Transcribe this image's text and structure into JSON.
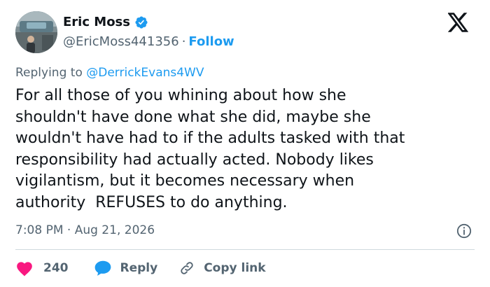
{
  "author": {
    "name": "Eric Moss",
    "handle": "@EricMoss441356",
    "separator": "·",
    "follow_label": "Follow"
  },
  "reply_context": {
    "prefix": "Replying to ",
    "mention": "@DerrickEvans4WV"
  },
  "tweet": {
    "text": "For all those of you whining about how she\nshouldn't have done what she did, maybe she\nwouldn't have had to if the adults tasked with that\nresponsibility had actually acted. Nobody likes\nvigilantism, but it becomes necessary when\nauthority  REFUSES to do anything.",
    "timestamp": "7:08 PM · Aug 21, 2026"
  },
  "actions": {
    "like_count": "240",
    "reply_label": "Reply",
    "copy_label": "Copy link"
  },
  "icons": {
    "logo": "x-logo-icon",
    "verified": "verified-badge-icon",
    "info": "info-icon",
    "like": "heart-icon",
    "reply": "reply-bubble-icon",
    "copy": "link-icon"
  },
  "colors": {
    "accent": "#1d9bf0",
    "like": "#f91880",
    "text": "#0f1419",
    "muted": "#536471"
  }
}
